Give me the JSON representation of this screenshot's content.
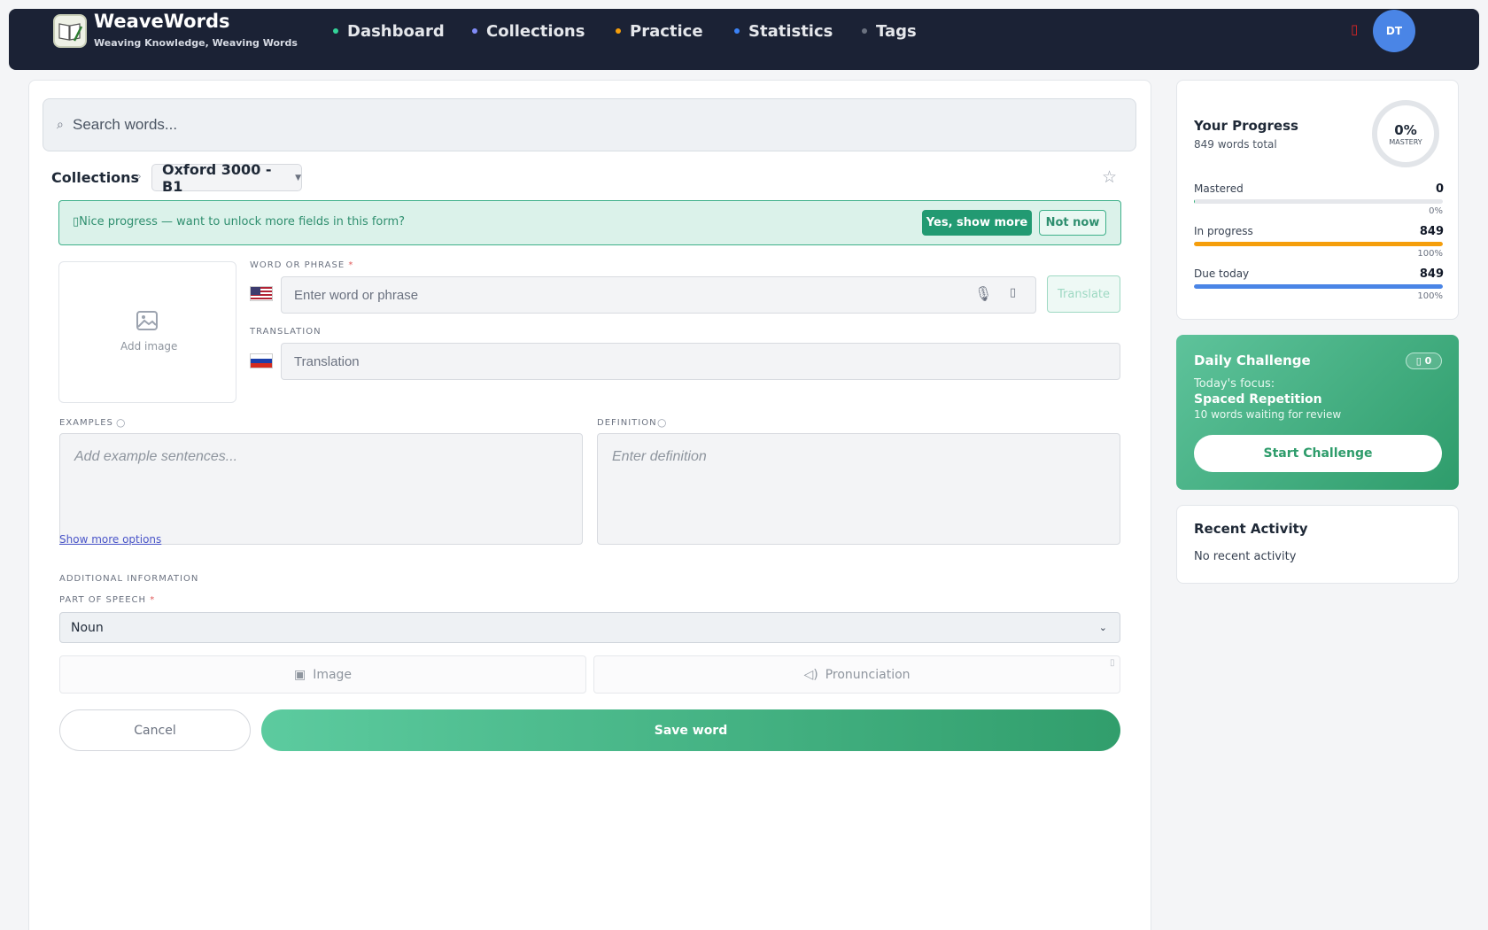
{
  "app": {
    "name": "WeaveWords",
    "tagline": "Weaving Knowledge, Weaving Words"
  },
  "nav": {
    "items": [
      {
        "label": "Dashboard",
        "dot_color": "#34d399"
      },
      {
        "label": "Collections",
        "dot_color": "#818cf8"
      },
      {
        "label": "Practice",
        "dot_color": "#f59e0b"
      },
      {
        "label": "Statistics",
        "dot_color": "#3b82f6"
      },
      {
        "label": "Tags",
        "dot_color": "#6b7280"
      }
    ],
    "notification_icon": "bell-icon",
    "avatar_initials": "DT"
  },
  "search": {
    "placeholder": "Search words..."
  },
  "breadcrumb": {
    "root": "Collections",
    "selected_collection": "Oxford 3000 - B1"
  },
  "banner": {
    "text": "Nice progress — want to unlock more fields in this form?",
    "yes_label": "Yes, show more",
    "no_label": "Not now"
  },
  "form": {
    "add_image_label": "Add image",
    "word_label": "WORD OR PHRASE",
    "word_placeholder": "Enter word or phrase",
    "translate_label": "Translate",
    "translation_label": "TRANSLATION",
    "translation_placeholder": "Translation",
    "examples_label": "EXAMPLES",
    "examples_placeholder": "Add example sentences...",
    "definition_label": "DEFINITION",
    "definition_placeholder": "Enter definition",
    "show_more_label": "Show more options",
    "additional_label": "ADDITIONAL INFORMATION",
    "pos_label": "PART OF SPEECH",
    "pos_value": "Noun",
    "image_button": "Image",
    "pronunciation_button": "Pronunciation",
    "cancel_label": "Cancel",
    "save_label": "Save word",
    "required_marker": "*"
  },
  "progress": {
    "title": "Your Progress",
    "subtitle": "849 words total",
    "mastery_pct": "0%",
    "mastery_label": "MASTERY",
    "stats": [
      {
        "label": "Mastered",
        "value": "0",
        "pct": "0%",
        "fraction": 0.005,
        "color": "#34b37b"
      },
      {
        "label": "In progress",
        "value": "849",
        "pct": "100%",
        "fraction": 1.0,
        "color": "#f59e0b"
      },
      {
        "label": "Due today",
        "value": "849",
        "pct": "100%",
        "fraction": 1.0,
        "color": "#4a85e6"
      }
    ]
  },
  "challenge": {
    "title": "Daily Challenge",
    "badge": "0",
    "focus_label": "Today's focus:",
    "topic": "Spaced Repetition",
    "waiting": "10 words waiting for review",
    "start_label": "Start Challenge"
  },
  "activity": {
    "title": "Recent Activity",
    "empty": "No recent activity"
  }
}
